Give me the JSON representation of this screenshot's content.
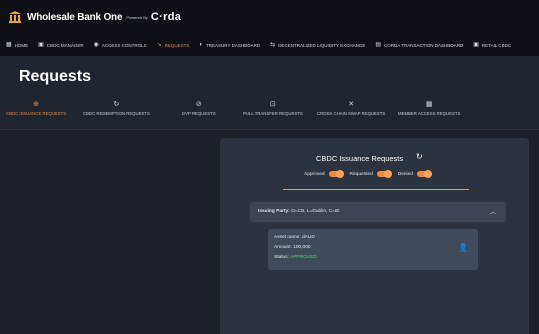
{
  "brand": {
    "title": "Wholesale Bank One",
    "powered_by": "Powered By",
    "logo_text": "C·rda"
  },
  "nav": {
    "items": [
      {
        "label": "HOME",
        "icon": "grid-icon",
        "glyph": "▦",
        "active": false
      },
      {
        "label": "CBDC MANAGER",
        "icon": "wallet-icon",
        "glyph": "▣",
        "active": false
      },
      {
        "label": "ACCESS CONTROLS",
        "icon": "shield-icon",
        "glyph": "◉",
        "active": false
      },
      {
        "label": "REQUESTS",
        "icon": "request-icon",
        "glyph": "↘",
        "active": true
      },
      {
        "label": "TREASURY DASHBOARD",
        "icon": "treasury-icon",
        "glyph": "◐",
        "active": false
      },
      {
        "label": "DECENTRALIZED LIQUIDITY EXCHANGE",
        "icon": "exchange-icon",
        "glyph": "⇆",
        "active": false
      },
      {
        "label": "CORDA TRANSACTION DASHBOARD",
        "icon": "dashboard-icon",
        "glyph": "▤",
        "active": false
      },
      {
        "label": "RETAIL CBDC",
        "icon": "retail-icon",
        "glyph": "▣",
        "active": false
      }
    ]
  },
  "page": {
    "title": "Requests"
  },
  "tabs": [
    {
      "label": "CBDC ISSUANCE REQUESTS",
      "icon": "coin-icon",
      "glyph": "⊕",
      "active": true
    },
    {
      "label": "CBDC REDEMPTION REQUESTS",
      "icon": "redeem-icon",
      "glyph": "↻",
      "active": false
    },
    {
      "label": "DVP REQUESTS",
      "icon": "dvp-icon",
      "glyph": "⊘",
      "active": false
    },
    {
      "label": "PULL TRANSFER REQUESTS",
      "icon": "transfer-icon",
      "glyph": "⊡",
      "active": false
    },
    {
      "label": "CROSS CHAIN SWAP REQUESTS",
      "icon": "swap-icon",
      "glyph": "✕",
      "active": false
    },
    {
      "label": "MEMBER ACCESS REQUESTS",
      "icon": "member-icon",
      "glyph": "▦",
      "active": false
    }
  ],
  "panel": {
    "title": "CBDC Issuance Requests",
    "filters": {
      "approved": "Approved",
      "requested": "Requested",
      "denied": "Denied"
    },
    "accordion": {
      "prefix": "Issuing Party:",
      "value": "O=CB, L=Dublin, C=IE"
    },
    "card": {
      "asset_label": "Asset name:",
      "asset_value": "dAUD",
      "amount_label": "Amount:",
      "amount_value": "100,000",
      "status_label": "Status:",
      "status_value": "APPROVED"
    }
  },
  "colors": {
    "accent": "#f0883e",
    "status_approved": "#5ad27a",
    "background": "#1b2029",
    "panel": "#2b3340"
  }
}
